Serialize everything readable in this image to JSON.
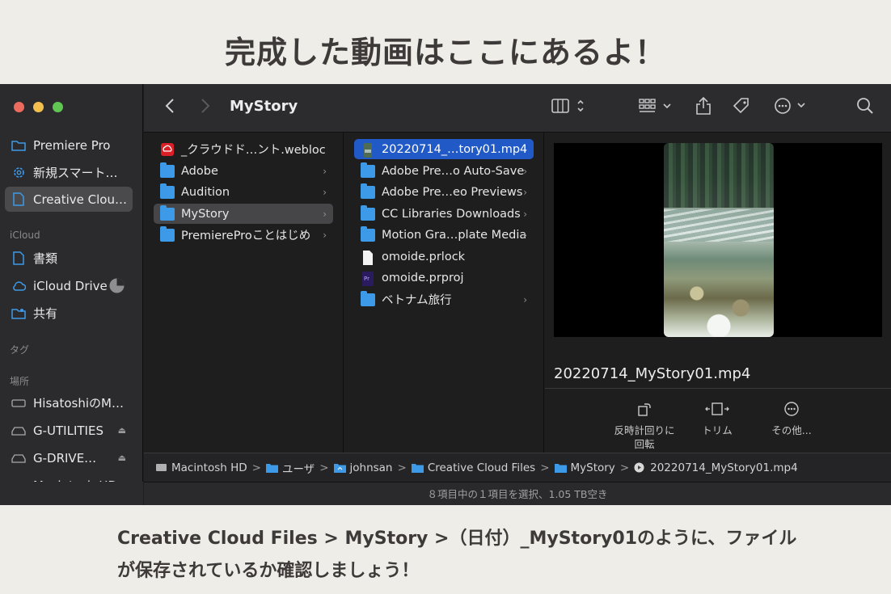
{
  "heading": "完成した動画はここにあるよ！",
  "caption_line1": "Creative Cloud Files > MyStory >（日付）_MyStory01のように、ファイル",
  "caption_line2": "が保存されているか確認しましょう！",
  "finder": {
    "title": "MyStory",
    "sidebar": {
      "favorites": [
        {
          "label": "Premiere Pro",
          "icon": "folder-icon"
        },
        {
          "label": "新規スマート…",
          "icon": "gear-icon"
        },
        {
          "label": "Creative Clou…",
          "icon": "document-icon",
          "selected": true
        }
      ],
      "icloud_header": "iCloud",
      "icloud": [
        {
          "label": "書類",
          "icon": "document-icon"
        },
        {
          "label": "iCloud Drive",
          "icon": "cloud-icon"
        },
        {
          "label": "共有",
          "icon": "shared-folder-icon"
        }
      ],
      "tags_header": "タグ",
      "locations_header": "場所",
      "locations": [
        {
          "label": "HisatoshiのM…",
          "icon": "laptop-icon"
        },
        {
          "label": "G-UTILITIES",
          "icon": "drive-icon",
          "eject": true
        },
        {
          "label": "G-DRIVE…",
          "icon": "drive-icon",
          "eject": true
        },
        {
          "label": "Macintosh HD",
          "icon": "drive-icon"
        }
      ]
    },
    "column1": [
      {
        "label": "_クラウドド…ント.webloc",
        "kind": "webloc"
      },
      {
        "label": "Adobe",
        "kind": "folder"
      },
      {
        "label": "Audition",
        "kind": "folder"
      },
      {
        "label": "MyStory",
        "kind": "folder",
        "selected": true
      },
      {
        "label": "PremiereProことはじめ",
        "kind": "folder"
      }
    ],
    "column2": [
      {
        "label": "20220714_…tory01.mp4",
        "kind": "video",
        "selected": true
      },
      {
        "label": "Adobe Pre…o Auto-Save",
        "kind": "folder"
      },
      {
        "label": "Adobe Pre…eo Previews",
        "kind": "folder"
      },
      {
        "label": "CC Libraries Downloads",
        "kind": "folder"
      },
      {
        "label": "Motion Gra…plate Media",
        "kind": "folder"
      },
      {
        "label": "omoide.prlock",
        "kind": "file"
      },
      {
        "label": "omoide.prproj",
        "kind": "premiere"
      },
      {
        "label": "ベトナム旅行",
        "kind": "folder"
      }
    ],
    "preview": {
      "filename": "20220714_MyStory01.mp4",
      "actions": [
        {
          "label": "反時計回りに回転",
          "line1": "反時計回りに",
          "line2": "回転",
          "icon": "rotate-left-icon"
        },
        {
          "label": "トリム",
          "icon": "trim-icon"
        },
        {
          "label": "その他...",
          "icon": "more-icon"
        }
      ]
    },
    "pathbar": [
      {
        "label": "Macintosh HD",
        "icon": "drive-icon"
      },
      {
        "label": "ユーザ",
        "icon": "folder-icon"
      },
      {
        "label": "johnsan",
        "icon": "home-folder-icon"
      },
      {
        "label": "Creative Cloud Files",
        "icon": "folder-icon"
      },
      {
        "label": "MyStory",
        "icon": "folder-icon"
      },
      {
        "label": "20220714_MyStory01.mp4",
        "icon": "video-file-icon"
      }
    ],
    "status": "８項目中の１項目を選択、1.05 TB空き"
  },
  "colors": {
    "accent_blue": "#2159c6",
    "folder_blue": "#3d9ae8",
    "background": "#efede8",
    "text_dark": "#3e3a39"
  }
}
